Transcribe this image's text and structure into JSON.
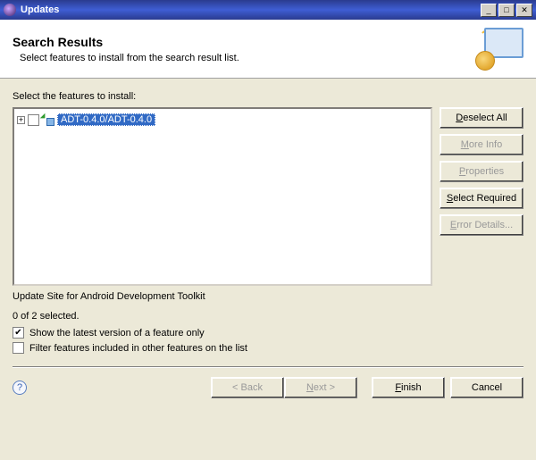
{
  "window": {
    "title": "Updates"
  },
  "banner": {
    "heading": "Search Results",
    "subtext": "Select features to install from the search result list."
  },
  "instruction": "Select the features to install:",
  "tree": {
    "items": [
      {
        "label": "ADT-0.4.0/ADT-0.4.0",
        "checked": false,
        "expanded": false
      }
    ]
  },
  "side": {
    "deselect_all": "Deselect All",
    "more_info": "More Info",
    "properties": "Properties",
    "select_required": "Select Required",
    "error_details": "Error Details..."
  },
  "status_line": "Update Site for Android Development Toolkit",
  "selection_count": "0 of 2 selected.",
  "options": {
    "show_latest": {
      "label": "Show the latest version of a feature only",
      "checked": true
    },
    "filter_included": {
      "label": "Filter features included in other features on the list",
      "checked": false
    }
  },
  "footer": {
    "back": "< Back",
    "next": "Next >",
    "finish": "Finish",
    "cancel": "Cancel"
  }
}
